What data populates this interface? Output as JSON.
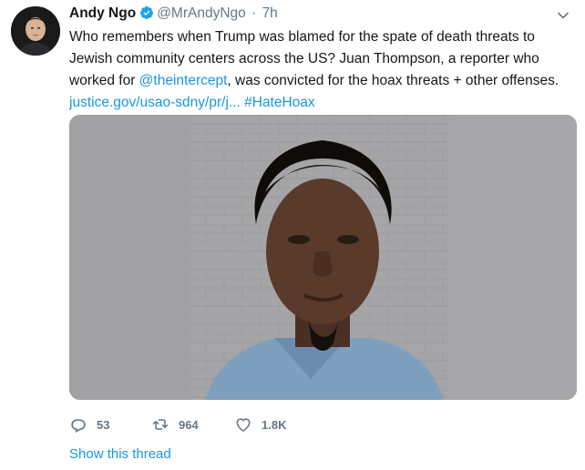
{
  "tweet": {
    "author_name": "Andy Ngo",
    "handle": "@MrAndyNgo",
    "separator": "·",
    "time": "7h",
    "text_part1": "Who remembers when Trump was blamed for the spate of death threats to Jewish community centers across the US? Juan Thompson, a reporter who worked for ",
    "mention": "@theintercept",
    "text_part2": ", was convicted for the hoax threats + other offenses.",
    "link_url": "justice.gov/usao-sdny/pr/j...",
    "hashtag": "#HateHoax",
    "accent_color": "#1b95e0",
    "verified_color": "#1da1f2"
  },
  "icons": {
    "verified": "verified-badge-icon",
    "menu": "chevron-down-icon",
    "reply": "reply-icon",
    "retweet": "retweet-icon",
    "like": "heart-icon"
  },
  "actions": {
    "replies": "53",
    "retweets": "964",
    "likes": "1.8K"
  },
  "show_thread": "Show this thread"
}
